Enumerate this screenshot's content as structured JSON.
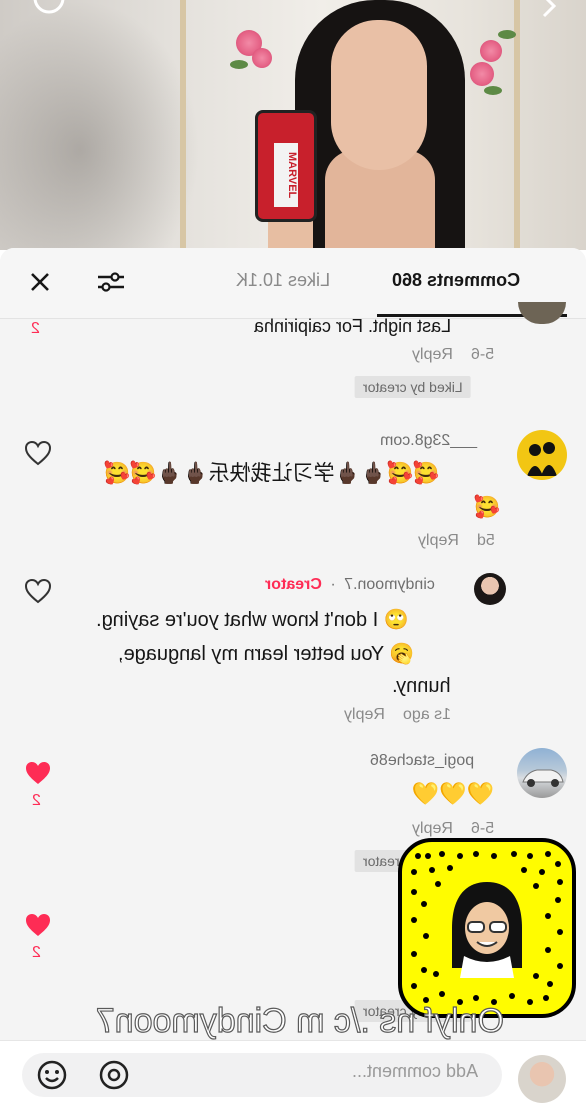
{
  "video": {
    "phone_case_text": "MARVEL"
  },
  "header": {
    "tabs": [
      {
        "label": "Comments 860",
        "active": true
      },
      {
        "label": "Likes 10.1K",
        "active": false
      }
    ],
    "close_icon": "close-icon",
    "filter_icon": "filter-sliders-icon"
  },
  "comments": [
    {
      "text_tail": "Last night. For caipirinha",
      "meta_time": "5-6",
      "reply_label": "Reply",
      "liked_chip": "Liked by creator",
      "like_count": "2"
    },
    {
      "username": "___23g8.com",
      "line1": "🥰🥰🖕🏿🖕🏿学习让我快乐🖕🏿🖕🏿🥰🥰",
      "line2": "🥰",
      "meta_time": "5d",
      "reply_label": "Reply"
    },
    {
      "username": "cindymoon.7",
      "creator_badge": "Creator",
      "separator": "·",
      "line1": "🙄 I don't know what you're saying.",
      "line2": "🥱 You better learn my language,",
      "line3": "hunny.",
      "meta_time": "1s ago",
      "reply_label": "Reply"
    },
    {
      "username": "pogi_stache86",
      "line1": "💛💛💛",
      "meta_time": "5-6",
      "reply_label": "Reply",
      "liked_chip": "Liked by creator",
      "like_count": "2"
    },
    {
      "like_count": "2",
      "liked_chip": "Liked by creator"
    }
  ],
  "overlay": {
    "text": "Onlyf ns ./c m Cindymoon7"
  },
  "input": {
    "placeholder": "Add comment..."
  },
  "colors": {
    "accent": "#fe2c55",
    "snap_yellow": "#fffc00",
    "emoji_yellow": "#f6c33b"
  }
}
